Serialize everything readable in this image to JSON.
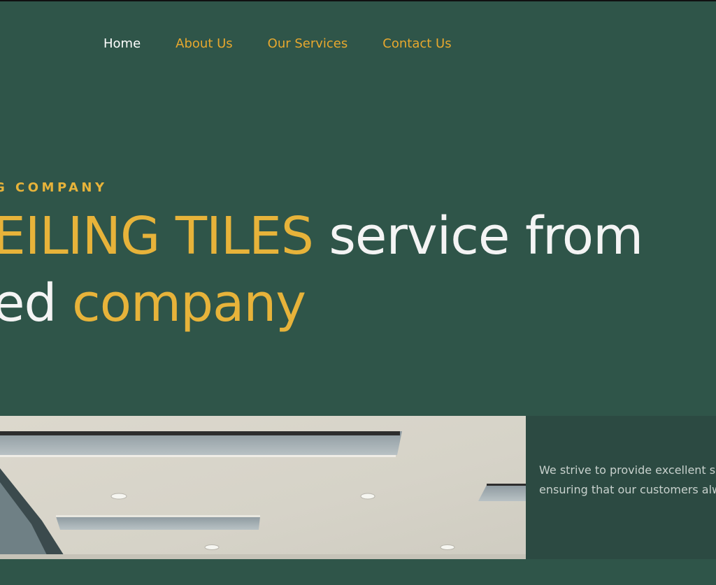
{
  "nav": {
    "items": [
      {
        "label": "Home",
        "active": true
      },
      {
        "label": "About Us",
        "active": false
      },
      {
        "label": "Our Services",
        "active": false
      },
      {
        "label": "Contact Us",
        "active": false
      }
    ]
  },
  "hero": {
    "eyebrow": "G COMPANY",
    "line1_highlight": "EILING TILES",
    "line1_rest": " service from",
    "line2_start": "ed ",
    "line2_highlight": "company"
  },
  "info": {
    "line1": "We strive to provide excellent s",
    "line2": "ensuring that our customers alw"
  },
  "colors": {
    "background": "#2f5549",
    "accent": "#e7b33a",
    "panel": "#2c4a42",
    "text_light": "#f4f4f4"
  }
}
